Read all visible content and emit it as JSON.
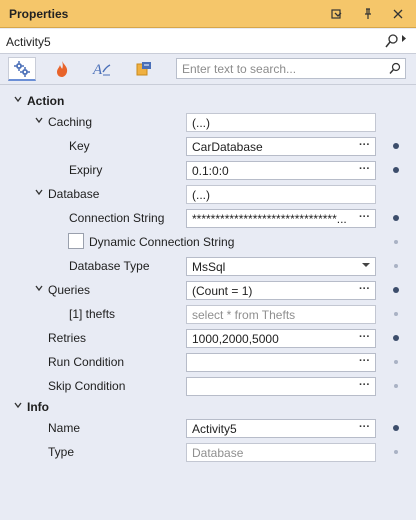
{
  "window": {
    "title": "Properties"
  },
  "object": {
    "name": "Activity5"
  },
  "search": {
    "placeholder": "Enter text to search..."
  },
  "ellipsis": "···",
  "rows": {
    "action": {
      "label": "Action"
    },
    "caching": {
      "label": "Caching",
      "value": "(...)"
    },
    "key": {
      "label": "Key",
      "value": "CarDatabase"
    },
    "expiry": {
      "label": "Expiry",
      "value": "0.1:0:0"
    },
    "database": {
      "label": "Database",
      "value": "(...)"
    },
    "connstr": {
      "label": "Connection String",
      "value": "*******************************..."
    },
    "dynconn": {
      "label": "Dynamic Connection String"
    },
    "dbtype": {
      "label": "Database Type",
      "value": "MsSql"
    },
    "queries": {
      "label": "Queries",
      "value": "(Count = 1)"
    },
    "thefts": {
      "label": "[1] thefts",
      "value": "select * from Thefts"
    },
    "retries": {
      "label": "Retries",
      "value": "1000,2000,5000"
    },
    "runcond": {
      "label": "Run Condition",
      "value": ""
    },
    "skipcond": {
      "label": "Skip Condition",
      "value": ""
    },
    "info": {
      "label": "Info"
    },
    "name": {
      "label": "Name",
      "value": "Activity5"
    },
    "type": {
      "label": "Type",
      "value": "Database"
    }
  },
  "colors": {
    "titlebar": "#f5c66a",
    "panel": "#e8ebf4",
    "accent": "#6b8fd6"
  }
}
